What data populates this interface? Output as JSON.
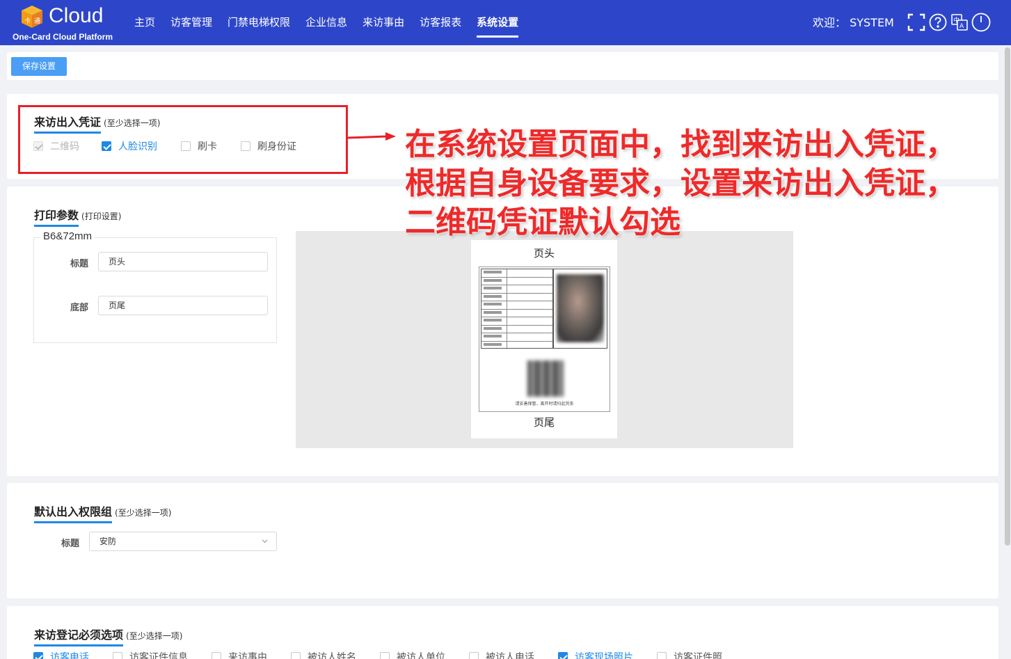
{
  "header": {
    "logo_text": "Cloud",
    "logo_subtitle": "One-Card Cloud Platform",
    "nav": [
      {
        "label": "主页"
      },
      {
        "label": "访客管理"
      },
      {
        "label": "门禁电梯权限"
      },
      {
        "label": "企业信息"
      },
      {
        "label": "来访事由"
      },
      {
        "label": "访客报表"
      },
      {
        "label": "系统设置",
        "active": true
      }
    ],
    "welcome": "欢迎： SYSTEM",
    "icons": [
      "fullscreen-icon",
      "help-icon",
      "language-icon",
      "power-icon"
    ]
  },
  "toolbar": {
    "save_label": "保存设置"
  },
  "credential": {
    "title": "来访出入凭证",
    "hint": "(至少选择一项)",
    "options": [
      {
        "label": "二维码",
        "checked": true,
        "disabled": true
      },
      {
        "label": "人脸识别",
        "checked": true,
        "disabled": false
      },
      {
        "label": "刷卡",
        "checked": false,
        "disabled": false
      },
      {
        "label": "刷身份证",
        "checked": false,
        "disabled": false
      }
    ]
  },
  "annotation": {
    "lines": [
      "在系统设置页面中，找到来访出入凭证，",
      "根据自身设备要求，设置来访出入凭证，",
      "二维码凭证默认勾选"
    ],
    "color": "#ee2a2a"
  },
  "print": {
    "title": "打印参数",
    "hint": "(打印设置)",
    "paper_size": "B6&72mm",
    "title_label": "标题",
    "title_value": "页头",
    "footer_label": "底部",
    "footer_value": "页尾",
    "preview": {
      "header": "页头",
      "footer": "页尾",
      "note": "请妥善保管，离开时请扫此凭条"
    }
  },
  "access_group": {
    "title": "默认出入权限组",
    "hint": "(至少选择一项)",
    "label": "标题",
    "selected": "安防"
  },
  "registration": {
    "title": "来访登记必须选项",
    "hint": "(至少选择一项)",
    "options": [
      {
        "label": "访客电话",
        "checked": true
      },
      {
        "label": "访客证件信息",
        "checked": false
      },
      {
        "label": "来访事由",
        "checked": false
      },
      {
        "label": "被访人姓名",
        "checked": false
      },
      {
        "label": "被访人单位",
        "checked": false
      },
      {
        "label": "被访人电话",
        "checked": false
      },
      {
        "label": "访客现场照片",
        "checked": true
      },
      {
        "label": "访客证件照",
        "checked": false
      }
    ]
  },
  "colors": {
    "header_bg": "#2d46c9",
    "accent": "#1e88e5",
    "save_button": "#4a9ef5",
    "annotation_box": "#e8202a"
  }
}
